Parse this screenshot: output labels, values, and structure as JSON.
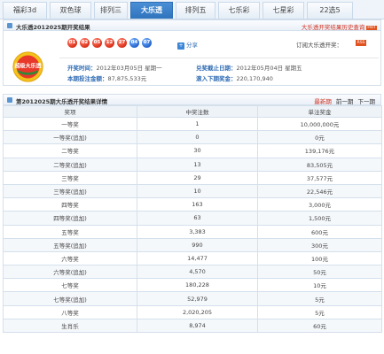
{
  "tabs": [
    {
      "label": "福彩3d",
      "active": false
    },
    {
      "label": "双色球",
      "active": false
    },
    {
      "label": "排列三",
      "active": false
    },
    {
      "label": "大乐透",
      "active": true
    },
    {
      "label": "排列五",
      "active": false
    },
    {
      "label": "七乐彩",
      "active": false
    },
    {
      "label": "七星彩",
      "active": false
    },
    {
      "label": "22选5",
      "active": false
    }
  ],
  "result_section": {
    "title": "大乐透2012025期开奖结果",
    "history_link": "大乐透开奖结果历史查询",
    "history_badge": "HOT"
  },
  "logo_text": "超级大乐透",
  "balls": [
    {
      "num": "01",
      "color": "red"
    },
    {
      "num": "02",
      "color": "red"
    },
    {
      "num": "05",
      "color": "red"
    },
    {
      "num": "12",
      "color": "red"
    },
    {
      "num": "27",
      "color": "red"
    },
    {
      "num": "04",
      "color": "blue"
    },
    {
      "num": "07",
      "color": "blue"
    }
  ],
  "share_label": "分享",
  "subscribe_label": "订阅大乐透开奖：",
  "subscribe_badge": "RSS",
  "info": {
    "draw_time_label": "开奖时间：",
    "draw_time": "2012年03月05日 星期一",
    "deadline_label": "兑奖截止日期：",
    "deadline": "2012年05月04日 星期五",
    "sales_label": "本期投注金额：",
    "sales": "87,875,533元",
    "pool_label": "滚入下期奖金：",
    "pool": "220,170,940"
  },
  "detail_section": {
    "title": "第2012025期大乐透开奖结果详情",
    "link_latest": "最新期",
    "link_prev": "前一期",
    "link_next": "下一期"
  },
  "table": {
    "headers": [
      "奖项",
      "中奖注数",
      "单注奖金"
    ],
    "rows": [
      [
        "一等奖",
        "1",
        "10,000,000元"
      ],
      [
        "一等奖(追加)",
        "0",
        "0元"
      ],
      [
        "二等奖",
        "30",
        "139,176元"
      ],
      [
        "二等奖(追加)",
        "13",
        "83,505元"
      ],
      [
        "三等奖",
        "29",
        "37,577元"
      ],
      [
        "三等奖(追加)",
        "10",
        "22,546元"
      ],
      [
        "四等奖",
        "163",
        "3,000元"
      ],
      [
        "四等奖(追加)",
        "63",
        "1,500元"
      ],
      [
        "五等奖",
        "3,383",
        "600元"
      ],
      [
        "五等奖(追加)",
        "990",
        "300元"
      ],
      [
        "六等奖",
        "14,477",
        "100元"
      ],
      [
        "六等奖(追加)",
        "4,570",
        "50元"
      ],
      [
        "七等奖",
        "180,228",
        "10元"
      ],
      [
        "七等奖(追加)",
        "52,979",
        "5元"
      ],
      [
        "八等奖",
        "2,020,205",
        "5元"
      ],
      [
        "生肖乐",
        "8,974",
        "60元"
      ]
    ]
  },
  "colors": {
    "accent_blue": "#2f73bd",
    "red_ball": "#e23a22",
    "blue_ball": "#2f6fd6",
    "link_red": "#d0301f"
  }
}
